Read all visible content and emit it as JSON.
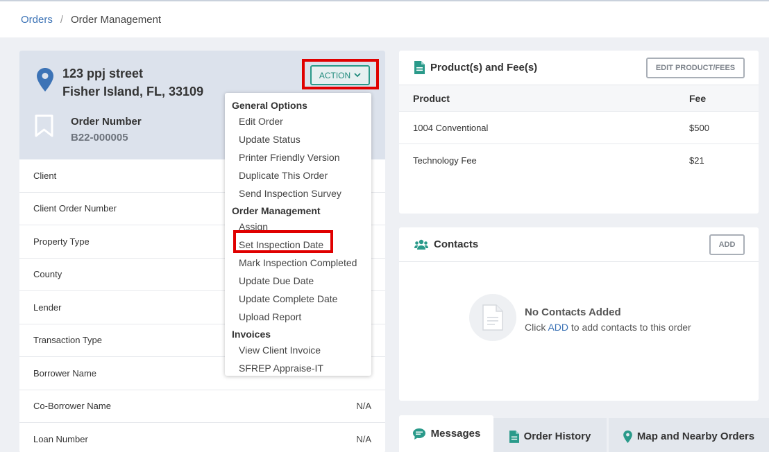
{
  "breadcrumb": {
    "parent": "Orders",
    "separator": "/",
    "current": "Order Management"
  },
  "order": {
    "address_line1": "123 ppj street",
    "address_line2": "Fisher Island, FL, 33109",
    "number_label": "Order Number",
    "number_value": "B22-000005"
  },
  "action_label": "ACTION",
  "details": [
    {
      "label": "Client",
      "value": ""
    },
    {
      "label": "Client Order Number",
      "value": ""
    },
    {
      "label": "Property Type",
      "value": ""
    },
    {
      "label": "County",
      "value": ""
    },
    {
      "label": "Lender",
      "value": ""
    },
    {
      "label": "Transaction Type",
      "value": ""
    },
    {
      "label": "Borrower Name",
      "value": ""
    },
    {
      "label": "Co-Borrower Name",
      "value": "N/A"
    },
    {
      "label": "Loan Number",
      "value": "N/A"
    }
  ],
  "menu": {
    "general": "General Options",
    "general_items": [
      "Edit Order",
      "Update Status",
      "Printer Friendly Version",
      "Duplicate This Order",
      "Send Inspection Survey"
    ],
    "management": "Order Management",
    "management_items": [
      "Assign",
      "Set Inspection Date",
      "Mark Inspection Completed",
      "Update Due Date",
      "Update Complete Date",
      "Upload Report"
    ],
    "invoices": "Invoices",
    "invoice_items": [
      "View Client Invoice",
      "SFREP Appraise-IT"
    ]
  },
  "products": {
    "title": "Product(s) and Fee(s)",
    "edit_button": "EDIT PRODUCT/FEES",
    "columns": [
      "Product",
      "Fee"
    ],
    "rows": [
      {
        "product": "1004 Conventional",
        "fee": "$500"
      },
      {
        "product": "Technology Fee",
        "fee": "$21"
      }
    ]
  },
  "contacts": {
    "title": "Contacts",
    "add_button": "ADD",
    "empty_title": "No Contacts Added",
    "empty_pre": "Click",
    "empty_link": "ADD",
    "empty_post": "to add contacts to this order"
  },
  "tabs": [
    "Messages",
    "Order History",
    "Map and Nearby Orders"
  ],
  "colors": {
    "accent": "#2a9a8a",
    "link": "#3c73b6",
    "highlight": "#e00000"
  }
}
